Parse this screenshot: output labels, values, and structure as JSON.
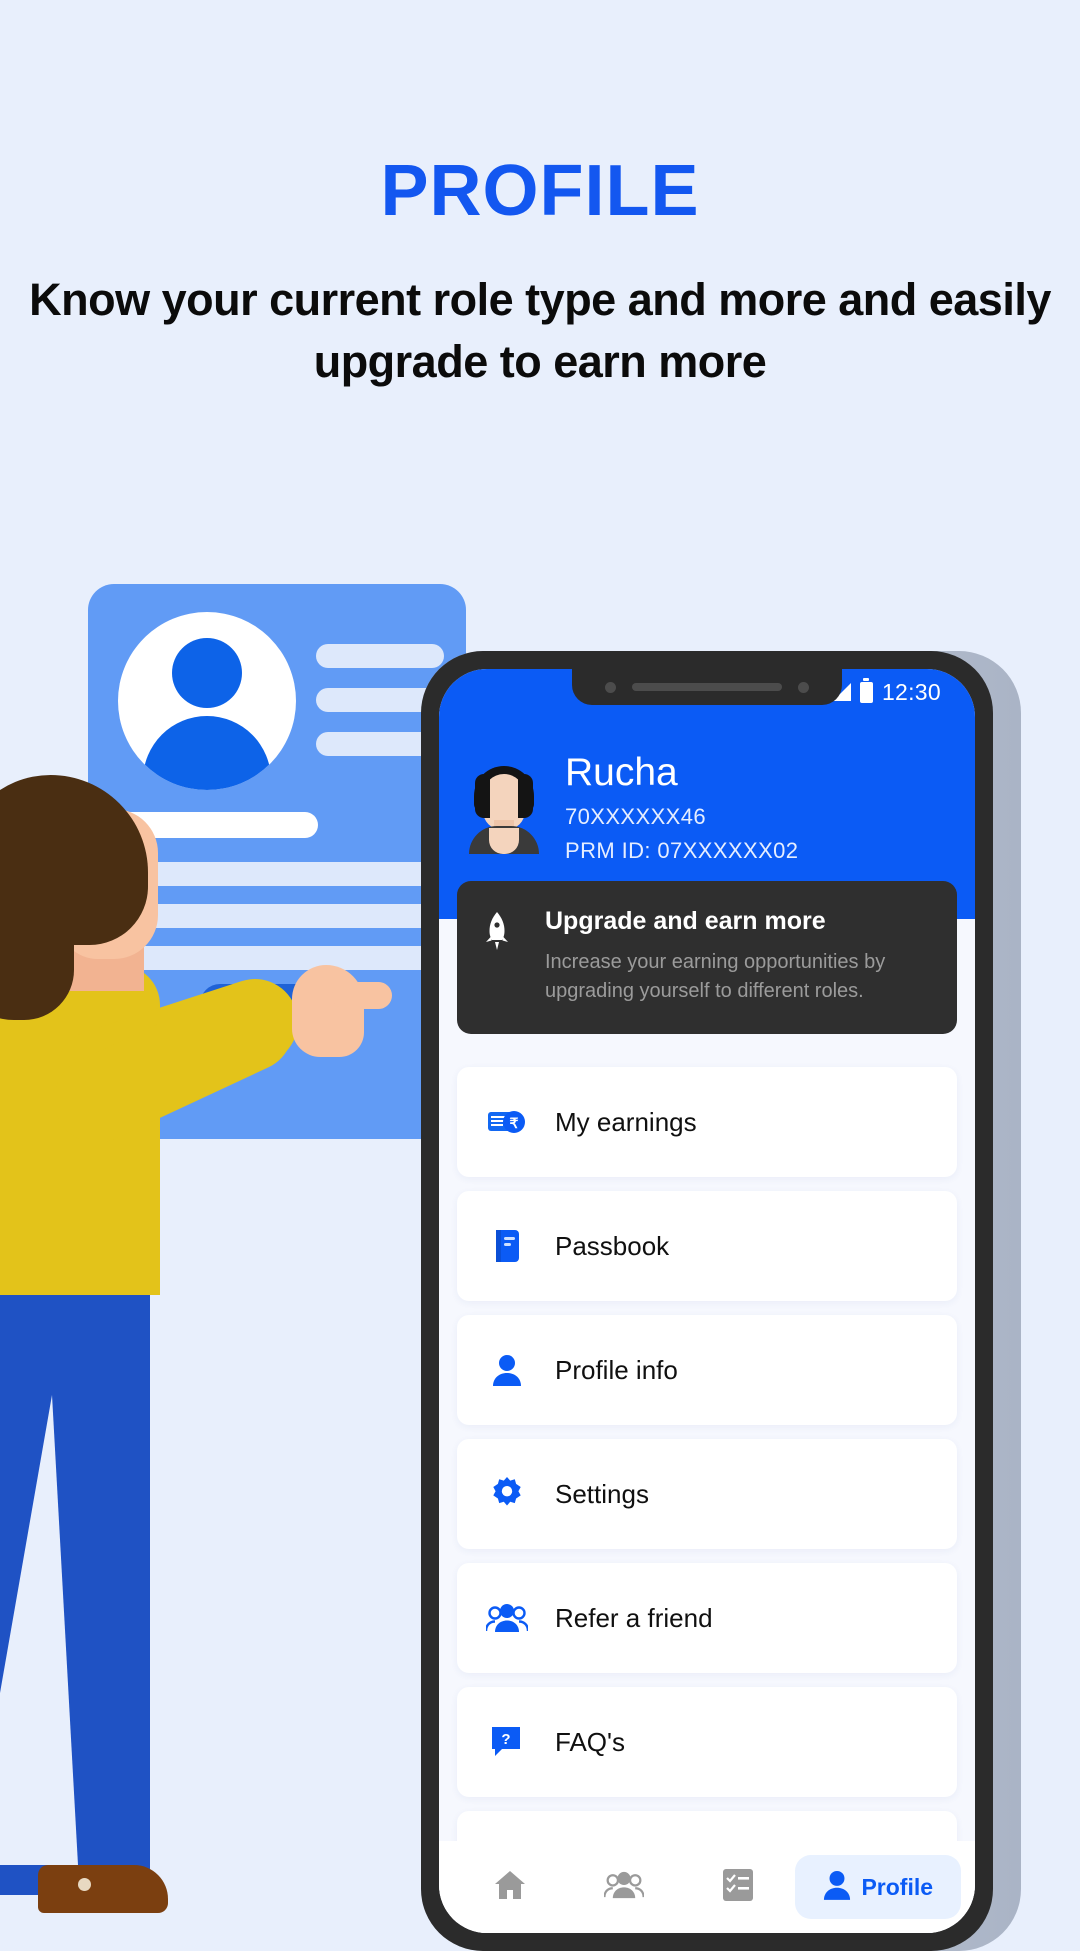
{
  "page": {
    "title": "PROFILE",
    "subtitle": "Know your current role type and more and easily upgrade to earn more",
    "background_color": "#e8effc",
    "accent_color": "#1357f0"
  },
  "phone": {
    "statusbar": {
      "time": "12:30",
      "signal_icon": "signal-bars-icon",
      "battery_icon": "battery-icon"
    },
    "header": {
      "background_color": "#0b5bf5",
      "avatar_icon": "user-avatar",
      "name": "Rucha",
      "phone_masked": "70XXXXXX46",
      "prm_id": "PRM ID: 07XXXXXX02"
    },
    "upgrade_banner": {
      "icon": "rocket-icon",
      "title": "Upgrade and earn more",
      "description": "Increase your earning opportunities by upgrading yourself to different roles.",
      "background_color": "#2f2f2f"
    },
    "menu_items": [
      {
        "label": "My earnings",
        "icon": "rupee-notes-icon"
      },
      {
        "label": "Passbook",
        "icon": "passbook-icon"
      },
      {
        "label": "Profile info",
        "icon": "person-icon"
      },
      {
        "label": "Settings",
        "icon": "gear-icon"
      },
      {
        "label": "Refer a friend",
        "icon": "people-group-icon"
      },
      {
        "label": "FAQ's",
        "icon": "question-bubble-icon"
      }
    ],
    "bottom_nav": [
      {
        "label": "",
        "icon": "home-icon",
        "active": false
      },
      {
        "label": "",
        "icon": "group-icon",
        "active": false
      },
      {
        "label": "",
        "icon": "checklist-icon",
        "active": false
      },
      {
        "label": "Profile",
        "icon": "person-icon",
        "active": true
      }
    ]
  },
  "illustration": {
    "card_color": "#619bf5",
    "shirt_color": "#e3c31a",
    "pants_color": "#1f52c4",
    "hair_color": "#4a2e12"
  }
}
